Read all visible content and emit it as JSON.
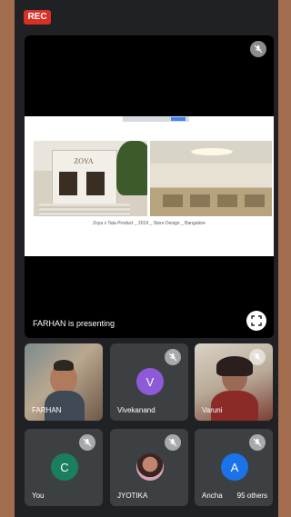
{
  "recording": {
    "label": "REC",
    "color": "#d93025"
  },
  "presentation": {
    "presenter_label": "FARHAN  is presenting",
    "slide_logo_text": "ZOYA",
    "slide_caption": "Zoya x Tata Product _ 2019 _ Store Design _ Bangalore",
    "slide_toolbar_button": "Stop Sharing"
  },
  "participants": [
    {
      "name": "FARHAN",
      "type": "video",
      "muted": true
    },
    {
      "name": "Vivekanand",
      "initial": "V",
      "color": "#8e5bd8",
      "muted": true
    },
    {
      "name": "Varuni",
      "type": "video",
      "muted": true
    },
    {
      "name": "You",
      "initial": "C",
      "color": "#1a7f5e",
      "muted": true
    },
    {
      "name": "JYOTIKA",
      "type": "photo",
      "muted": true
    },
    {
      "name": "Ancha",
      "initial": "A",
      "color": "#1a73e8",
      "muted": true
    }
  ],
  "others": {
    "label": "95 others"
  },
  "icons": {
    "mic_off": "mic-off-icon",
    "fullscreen": "fullscreen-icon"
  }
}
